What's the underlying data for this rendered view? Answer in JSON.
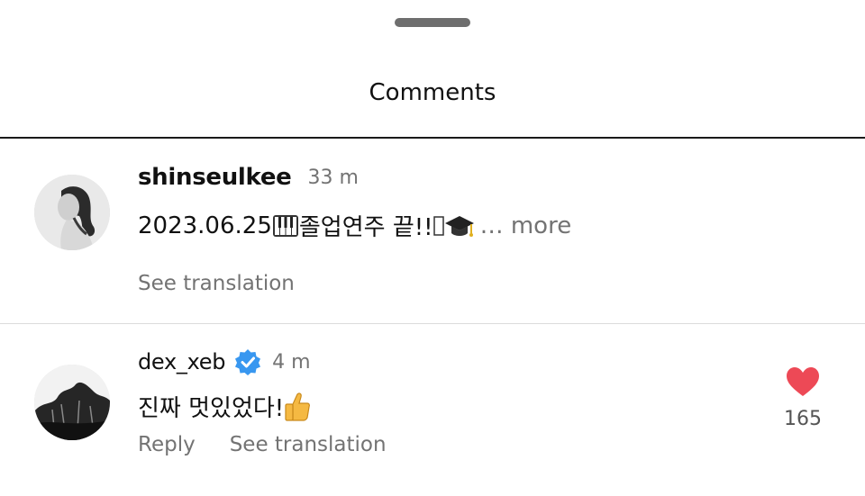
{
  "sheet": {
    "title": "Comments"
  },
  "comments": [
    {
      "username": "shinseulkee",
      "time": "33 m",
      "text_main": "2023.06.25",
      "text_after_piano": "졸업연주 끝!!",
      "text_more_prefix": "… ",
      "more_label": "more",
      "see_translation": "See translation",
      "icons": [
        "avatar",
        "piano-emoji",
        "unknown-glyph-icon",
        "graduation-cap-emoji"
      ]
    },
    {
      "username": "dex_xeb",
      "verified": true,
      "time": "4 m",
      "text": "진짜 멋있었다! ",
      "reply_label": "Reply",
      "see_translation": "See translation",
      "like_count": "165",
      "liked": true,
      "icons": [
        "avatar",
        "verified-badge-icon",
        "thumbs-up-emoji",
        "heart-icon"
      ],
      "colors": {
        "verified": "#3897f0",
        "heart": "#ed4956"
      }
    }
  ]
}
